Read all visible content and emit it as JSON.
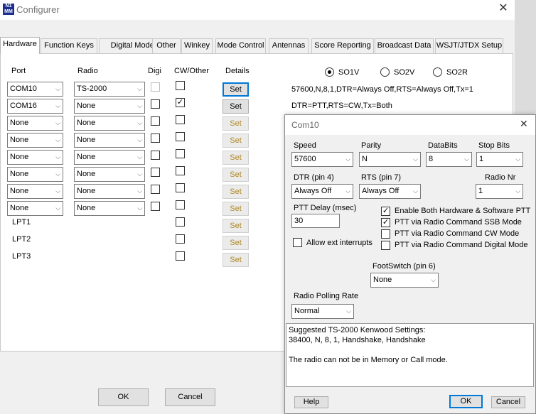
{
  "window": {
    "title": "Configurer",
    "close": "✕"
  },
  "tabs": [
    "Hardware",
    "Function Keys",
    "Digital Modes",
    "Other",
    "Winkey",
    "Mode Control",
    "Antennas",
    "Score Reporting",
    "Broadcast Data",
    "WSJT/JTDX Setup"
  ],
  "hardware": {
    "headers": {
      "port": "Port",
      "radio": "Radio",
      "digi": "Digi",
      "cw": "CW/Other",
      "details": "Details"
    },
    "rows": [
      {
        "port": "COM10",
        "radio": "TS-2000",
        "digi": false,
        "digi_enabled": false,
        "cw": false,
        "set": "Set",
        "set_enabled": true
      },
      {
        "port": "COM16",
        "radio": "None",
        "digi": false,
        "digi_enabled": true,
        "cw": true,
        "set": "Set",
        "set_enabled": true
      },
      {
        "port": "None",
        "radio": "None",
        "digi": false,
        "digi_enabled": true,
        "cw": false,
        "set": "Set",
        "set_enabled": false
      },
      {
        "port": "None",
        "radio": "None",
        "digi": false,
        "digi_enabled": true,
        "cw": false,
        "set": "Set",
        "set_enabled": false
      },
      {
        "port": "None",
        "radio": "None",
        "digi": false,
        "digi_enabled": true,
        "cw": false,
        "set": "Set",
        "set_enabled": false
      },
      {
        "port": "None",
        "radio": "None",
        "digi": false,
        "digi_enabled": true,
        "cw": false,
        "set": "Set",
        "set_enabled": false
      },
      {
        "port": "None",
        "radio": "None",
        "digi": false,
        "digi_enabled": true,
        "cw": false,
        "set": "Set",
        "set_enabled": false
      },
      {
        "port": "None",
        "radio": "None",
        "digi": false,
        "digi_enabled": true,
        "cw": false,
        "set": "Set",
        "set_enabled": false
      }
    ],
    "lpt_rows": [
      {
        "label": "LPT1",
        "set": "Set"
      },
      {
        "label": "LPT2",
        "set": "Set"
      },
      {
        "label": "LPT3",
        "set": "Set"
      }
    ],
    "so_options": [
      "SO1V",
      "SO2V",
      "SO2R"
    ],
    "so_selected": "SO1V",
    "status_line1": "57600,N,8,1,DTR=Always Off,RTS=Always Off,Tx=1",
    "status_line2": "DTR=PTT,RTS=CW,Tx=Both"
  },
  "buttons": {
    "ok": "OK",
    "cancel": "Cancel"
  },
  "com_dialog": {
    "title": "Com10",
    "close": "✕",
    "speed_label": "Speed",
    "speed": "57600",
    "parity_label": "Parity",
    "parity": "N",
    "databits_label": "DataBits",
    "databits": "8",
    "stopbits_label": "Stop Bits",
    "stopbits": "1",
    "dtr_label": "DTR (pin 4)",
    "dtr": "Always Off",
    "rts_label": "RTS (pin 7)",
    "rts": "Always Off",
    "radionr_label": "Radio Nr",
    "radionr": "1",
    "ptt_delay_label": "PTT Delay  (msec)",
    "ptt_delay": "30",
    "allow_ext_label": "Allow ext interrupts",
    "allow_ext": false,
    "options": [
      {
        "label": "Enable Both Hardware & Software PTT",
        "checked": true
      },
      {
        "label": "PTT via Radio Command SSB Mode",
        "checked": true
      },
      {
        "label": "PTT via Radio Command CW Mode",
        "checked": false
      },
      {
        "label": "PTT via Radio Command Digital Mode",
        "checked": false
      }
    ],
    "footswitch_label": "FootSwitch (pin 6)",
    "footswitch": "None",
    "polling_label": "Radio Polling Rate",
    "polling": "Normal",
    "suggested": "Suggested TS-2000 Kenwood Settings:\n38400, N, 8, 1, Handshake, Handshake\n\nThe radio can not be in Memory or Call mode.",
    "help": "Help",
    "ok": "OK",
    "cancel": "Cancel"
  }
}
